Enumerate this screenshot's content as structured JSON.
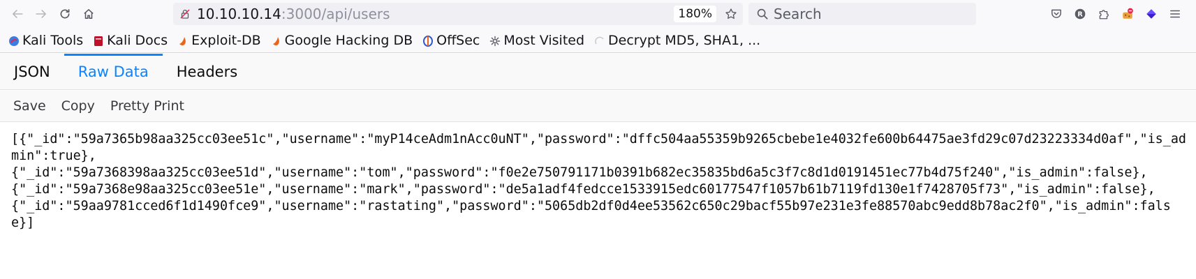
{
  "browser": {
    "url_host": "10.10.10.14",
    "url_rest": ":3000/api/users",
    "zoom": "180%",
    "search_placeholder": "Search",
    "profile_initial": "R"
  },
  "bookmarks": [
    {
      "label": "Kali Tools",
      "color": "#3b7de0"
    },
    {
      "label": "Kali Docs",
      "color": "#c0102b"
    },
    {
      "label": "Exploit-DB",
      "color": "#e8661c"
    },
    {
      "label": "Google Hacking DB",
      "color": "#e8661c"
    },
    {
      "label": "OffSec",
      "color": "#3355cc"
    },
    {
      "label": "Most Visited",
      "color": "#5b5b66"
    },
    {
      "label": "Decrypt MD5, SHA1, ...",
      "color": "#c9c9cf"
    }
  ],
  "viewer": {
    "tabs": [
      "JSON",
      "Raw Data",
      "Headers"
    ],
    "active_tab": "Raw Data",
    "raw_actions": [
      "Save",
      "Copy",
      "Pretty Print"
    ],
    "raw_text": "[{\"_id\":\"59a7365b98aa325cc03ee51c\",\"username\":\"myP14ceAdm1nAcc0uNT\",\"password\":\"dffc504aa55359b9265cbebe1e4032fe600b64475ae3fd29c07d23223334d0af\",\"is_admin\":true},\n{\"_id\":\"59a7368398aa325cc03ee51d\",\"username\":\"tom\",\"password\":\"f0e2e750791171b0391b682ec35835bd6a5c3f7c8d1d0191451ec77b4d75f240\",\"is_admin\":false},\n{\"_id\":\"59a7368e98aa325cc03ee51e\",\"username\":\"mark\",\"password\":\"de5a1adf4fedcce1533915edc60177547f1057b61b7119fd130e1f7428705f73\",\"is_admin\":false},\n{\"_id\":\"59aa9781cced6f1d1490fce9\",\"username\":\"rastating\",\"password\":\"5065db2df0d4ee53562c650c29bacf55b97e231e3fe88570abc9edd8b78ac2f0\",\"is_admin\":false}]"
  }
}
